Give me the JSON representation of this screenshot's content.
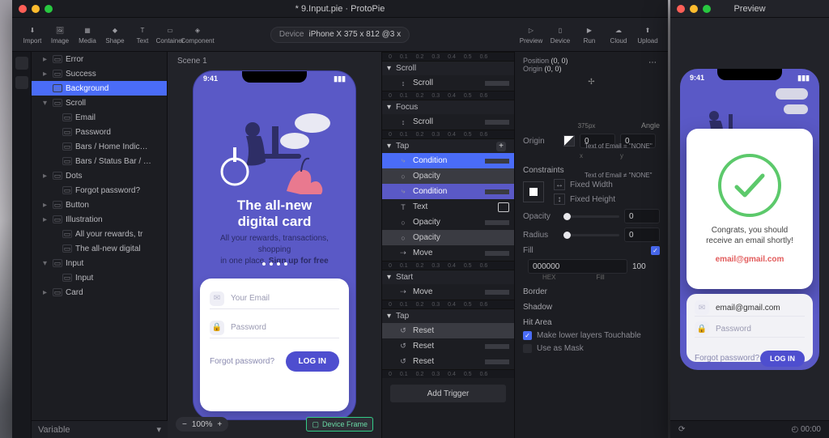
{
  "window": {
    "title": "* 9.Input.pie · ProtoPie"
  },
  "toolbar": {
    "items": [
      "Import",
      "Image",
      "Media",
      "Shape",
      "Text",
      "Container",
      "Component"
    ],
    "right": [
      "Preview",
      "Device",
      "Run",
      "Cloud",
      "Upload"
    ],
    "device_label": "Device",
    "device_value": "iPhone X  375 x 812  @3 x"
  },
  "canvas": {
    "scene_label": "Scene 1",
    "zoom": "100%",
    "device_frame": "Device Frame"
  },
  "layers": {
    "items": [
      {
        "i": 1,
        "c": "▸",
        "n": "Error"
      },
      {
        "i": 1,
        "c": "▸",
        "n": "Success"
      },
      {
        "i": 1,
        "c": "",
        "n": "Background",
        "sel": true
      },
      {
        "i": 1,
        "c": "▾",
        "n": "Scroll"
      },
      {
        "i": 2,
        "c": "",
        "n": "Email"
      },
      {
        "i": 2,
        "c": "",
        "n": "Password"
      },
      {
        "i": 2,
        "c": "",
        "n": "Bars / Home Indic…"
      },
      {
        "i": 2,
        "c": "",
        "n": "Bars / Status Bar / …"
      },
      {
        "i": 1,
        "c": "▸",
        "n": "Dots"
      },
      {
        "i": 2,
        "c": "",
        "n": "Forgot password?"
      },
      {
        "i": 1,
        "c": "▸",
        "n": "Button"
      },
      {
        "i": 1,
        "c": "▸",
        "n": "Illustration"
      },
      {
        "i": 2,
        "c": "",
        "n": "All your rewards, tr"
      },
      {
        "i": 2,
        "c": "",
        "n": "The all-new digital"
      },
      {
        "i": 1,
        "c": "▾",
        "n": "Input"
      },
      {
        "i": 2,
        "c": "",
        "n": "Input"
      },
      {
        "i": 1,
        "c": "▸",
        "n": "Card"
      }
    ],
    "footer": "Variable"
  },
  "phone": {
    "clock": "9:41",
    "title_l1": "The all-new",
    "title_l2": "digital card",
    "sub_a": "All your rewards, transactions, shopping",
    "sub_b": "in one place. ",
    "sub_c": "Sign up for free",
    "email_ph": "Your Email",
    "pwd_ph": "Password",
    "forgot": "Forgot password?",
    "login": "LOG IN"
  },
  "triggers": {
    "groups": [
      {
        "name": "Scroll",
        "rows": [
          {
            "n": "Scroll",
            "ic": "↕"
          }
        ]
      },
      {
        "name": "Focus",
        "rows": [
          {
            "n": "Scroll",
            "ic": "↕"
          }
        ]
      },
      {
        "name": "Tap",
        "plus": true,
        "rows": [
          {
            "n": "Condition",
            "ic": "⤷",
            "sel": "sel",
            "note": "Text of Email = \"NONE\""
          },
          {
            "n": "Opacity",
            "ic": "○",
            "hi": true
          },
          {
            "n": "Condition",
            "ic": "⤷",
            "sel": "selb",
            "note": "Text of Email ≠ \"NONE\""
          },
          {
            "n": "Text",
            "ic": "T",
            "tbox": true
          },
          {
            "n": "Opacity",
            "ic": "○"
          },
          {
            "n": "Opacity",
            "ic": "○",
            "hi": true
          },
          {
            "n": "Move",
            "ic": "⇢"
          }
        ]
      },
      {
        "name": "Start",
        "rows": [
          {
            "n": "Move",
            "ic": "⇢"
          }
        ]
      },
      {
        "name": "Tap",
        "rows": [
          {
            "n": "Reset",
            "ic": "↺",
            "hi": true
          },
          {
            "n": "Reset",
            "ic": "↺"
          },
          {
            "n": "Reset",
            "ic": "↺"
          }
        ]
      }
    ],
    "add": "Add Trigger",
    "ruler": [
      "0",
      "0.1",
      "0.2",
      "0.3",
      "0.4",
      "0.5",
      "0.6"
    ]
  },
  "inspector": {
    "pos_label": "Position",
    "pos": "(0, 0)",
    "org_label": "Origin",
    "org": "(0, 0)",
    "size_hint": "375px",
    "angle": "Angle",
    "origin": "Origin",
    "ox": "0",
    "oy": "0",
    "oxs": "x",
    "oys": "y",
    "constraints": "Constraints",
    "fw": "Fixed Width",
    "fh": "Fixed Height",
    "opacity": "Opacity",
    "opv": "0",
    "radius": "Radius",
    "radv": "0",
    "fill": "Fill",
    "hex": "000000",
    "alpha": "100",
    "hexl": "HEX",
    "filll": "Fill",
    "border": "Border",
    "shadow": "Shadow",
    "hit": "Hit Area",
    "touch": "Make lower layers Touchable",
    "mask": "Use as Mask"
  },
  "preview": {
    "title": "Preview",
    "clock": "9:41",
    "modal_msg": "Congrats, you should receive an email shortly!",
    "modal_email": "email@gmail.com",
    "email_val": "email@gmail.com",
    "pwd_ph": "Password",
    "forgot": "Forgot password?",
    "login": "LOG IN",
    "time": "00:00",
    "refresh": "⟳"
  }
}
